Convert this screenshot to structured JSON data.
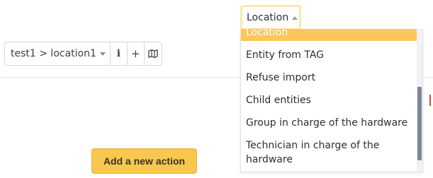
{
  "location_select": {
    "label": "Location"
  },
  "breadcrumb": {
    "path": "test1 > location1",
    "info_icon": "i",
    "add_icon": "+",
    "map_icon": "map-icon"
  },
  "actions": {
    "add_action_label": "Add a new action"
  },
  "dropdown": {
    "options": [
      "Location",
      "Entity from TAG",
      "Refuse import",
      "Child entities",
      "Group in charge of the hardware",
      "Technician in charge of the",
      "hardware"
    ],
    "selected": "Location"
  },
  "colors": {
    "accent": "#f9c74f",
    "selected_option": "#fbc75a",
    "scrollbar_thumb": "#7f8498"
  }
}
